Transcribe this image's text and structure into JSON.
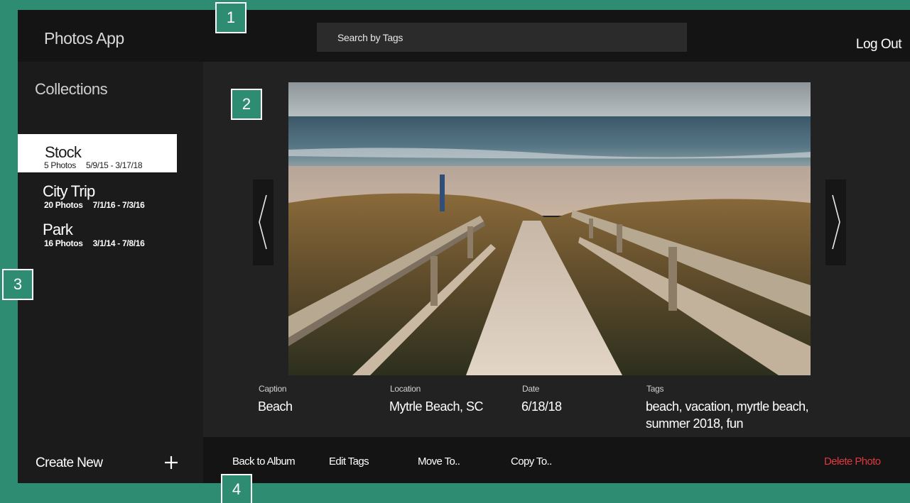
{
  "header": {
    "app_title": "Photos App",
    "search_placeholder": "Search by Tags",
    "logout_label": "Log Out"
  },
  "sidebar": {
    "title": "Collections",
    "albums": [
      {
        "name": "Stock",
        "count": "5 Photos",
        "dates": "5/9/15 - 3/17/18",
        "selected": true
      },
      {
        "name": "City Trip",
        "count": "20 Photos",
        "dates": "7/1/16 - 7/3/16",
        "selected": false
      },
      {
        "name": "Park",
        "count": "16 Photos",
        "dates": "3/1/14 - 7/8/16",
        "selected": false
      }
    ],
    "create_label": "Create New"
  },
  "photo": {
    "caption_label": "Caption",
    "caption": "Beach",
    "location_label": "Location",
    "location": "Mytrle Beach, SC",
    "date_label": "Date",
    "date": "6/18/18",
    "tags_label": "Tags",
    "tags": "beach, vacation, myrtle beach, summer 2018, fun"
  },
  "toolbar": {
    "back_label": "Back to Album",
    "edit_tags_label": "Edit Tags",
    "move_label": "Move To..",
    "copy_label": "Copy To..",
    "delete_label": "Delete Photo"
  },
  "markers": [
    "1",
    "2",
    "3",
    "4"
  ],
  "colors": {
    "frame": "#2e8c73",
    "panel": "#1b1b1b",
    "header": "#141414",
    "main": "#222222",
    "danger": "#e0383e"
  }
}
